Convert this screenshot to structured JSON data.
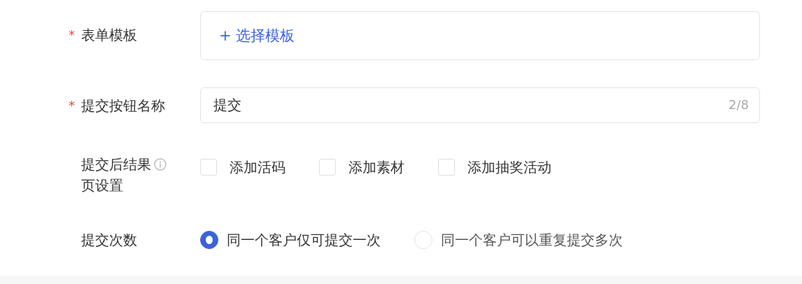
{
  "form": {
    "rows": [
      {
        "kind": "picker",
        "label": "表单模板",
        "required_mark": "*",
        "action": "+ 选择模板"
      },
      {
        "kind": "input",
        "label": "提交按钮名称",
        "required_mark": "*",
        "value": "提交",
        "counter": "2/8"
      },
      {
        "kind": "checkboxes",
        "label": "提交后结果页设置",
        "info": true,
        "options": [
          {
            "label": "添加活码",
            "checked": false
          },
          {
            "label": "添加素材",
            "checked": false
          },
          {
            "label": "添加抽奖活动",
            "checked": false
          }
        ]
      },
      {
        "kind": "radios",
        "label": "提交次数",
        "options": [
          {
            "label": "同一个客户仅可提交一次",
            "selected": true
          },
          {
            "label": "同一个客户可以重复提交多次",
            "selected": false
          }
        ]
      }
    ]
  }
}
